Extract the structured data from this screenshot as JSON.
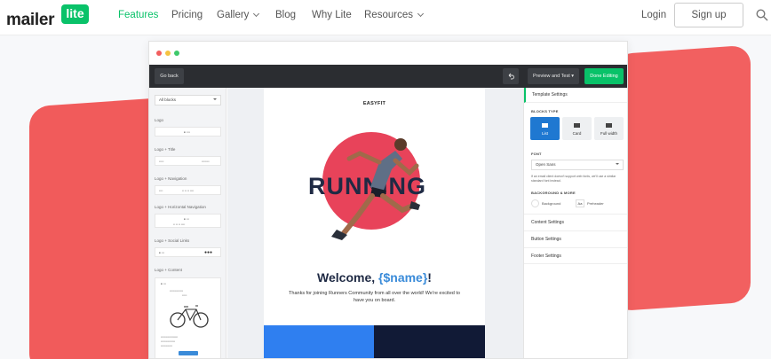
{
  "nav": {
    "logo_text": "mailer",
    "logo_badge": "lite",
    "items": [
      {
        "label": "Features",
        "active": true
      },
      {
        "label": "Pricing"
      },
      {
        "label": "Gallery"
      },
      {
        "label": "Blog"
      },
      {
        "label": "Why Lite"
      },
      {
        "label": "Resources"
      }
    ],
    "login": "Login",
    "signup": "Sign up",
    "accent": "#09c269"
  },
  "editor": {
    "toolbar": {
      "go_back": "Go back",
      "preview": "Preview and Test",
      "done": "Done Editing"
    },
    "blocks": {
      "filter": "All blocks",
      "groups": [
        {
          "title": "Logo"
        },
        {
          "title": "Logo + Title"
        },
        {
          "title": "Logo + Navigation"
        },
        {
          "title": "Logo + Horizontal Navigation"
        },
        {
          "title": "Logo + Social Links"
        },
        {
          "title": "Logo + Content"
        }
      ]
    },
    "email": {
      "brand": "EASYFIT",
      "hero_word": "RUNNING",
      "welcome_prefix": "Welcome, ",
      "welcome_var": "{$name}",
      "welcome_suffix": "!",
      "subtext": "Thanks for joining Runners Community from all over the world! We're excited to have you on board."
    },
    "settings": {
      "header": "Template Settings",
      "blocks_type_label": "BLOCKS TYPE",
      "types": [
        "List",
        "Card",
        "Full width"
      ],
      "font_label": "FONT",
      "font_value": "Open Sans",
      "font_note": "If an email client doesn't support web fonts, we'll use a similar standard font instead.",
      "bg_label": "BACKGROUND & MORE",
      "background": "Background",
      "preheader": "Preheader",
      "aa": "Aa",
      "sections": [
        "Content Settings",
        "Button Settings",
        "Footer Settings"
      ]
    }
  }
}
